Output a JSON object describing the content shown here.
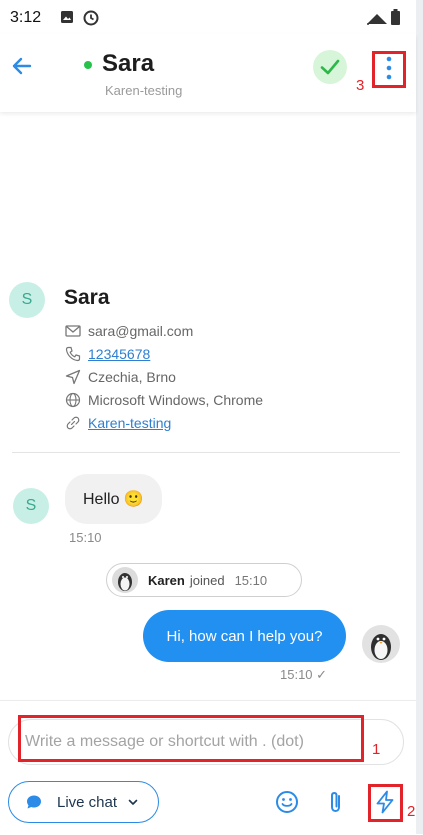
{
  "status_bar": {
    "time": "3:12"
  },
  "header": {
    "contact_name": "Sara",
    "group": "Karen-testing"
  },
  "annotations": {
    "label_1": "1",
    "label_2": "2",
    "label_3": "3"
  },
  "contact_card": {
    "avatar_letter": "S",
    "name": "Sara",
    "email": "sara@gmail.com",
    "phone": "12345678",
    "location": "Czechia, Brno",
    "system": "Microsoft Windows, Chrome",
    "group": "Karen-testing"
  },
  "messages": {
    "incoming_avatar_letter": "S",
    "incoming_text": "Hello 🙂",
    "incoming_time": "15:10",
    "joined_name": "Karen",
    "joined_text": "joined",
    "joined_time": "15:10",
    "outgoing_text": "Hi, how can I help you?",
    "outgoing_time": "15:10 ✓"
  },
  "composer": {
    "placeholder": "Write a message or shortcut with . (dot)",
    "live_chat_label": "Live chat"
  },
  "colors": {
    "accent_blue": "#2190f0",
    "online_green": "#27c24c",
    "annotation_red": "#e2232a"
  }
}
